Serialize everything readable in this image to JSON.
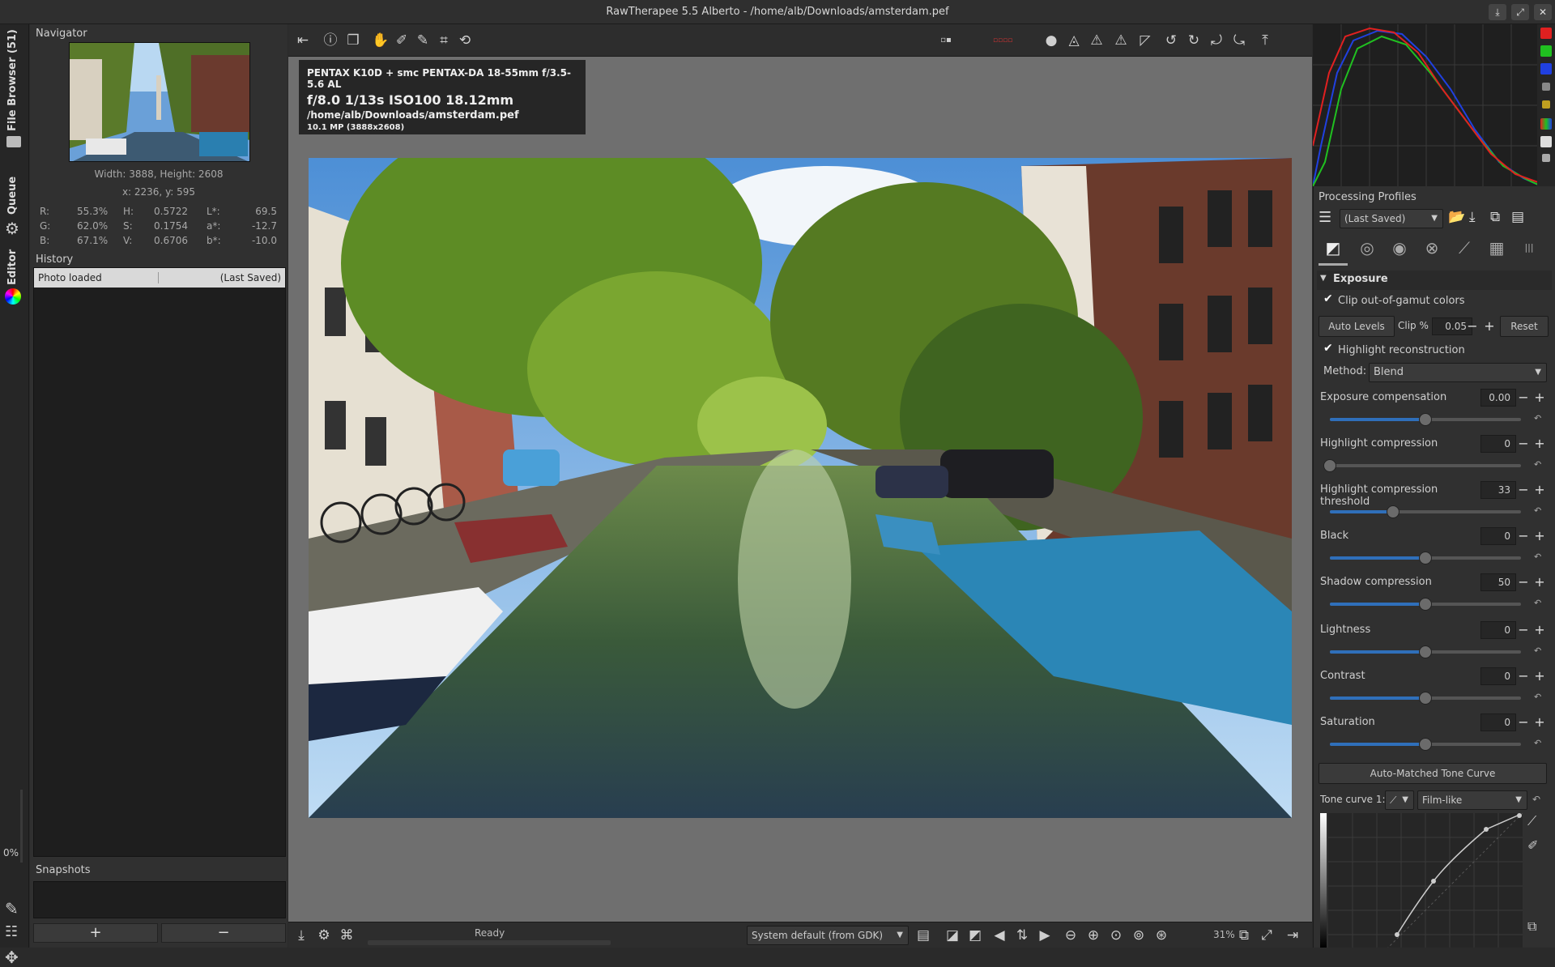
{
  "window": {
    "title": "RawTherapee 5.5 Alberto - /home/alb/Downloads/amsterdam.pef"
  },
  "left_tabs": {
    "file_browser": "File Browser (51)",
    "queue": "Queue",
    "editor": "Editor",
    "zoom_percent": "0%"
  },
  "navigator": {
    "header": "Navigator",
    "dimensions": "Width: 3888, Height: 2608",
    "coords": "x: 2236, y: 595",
    "r_label": "R:",
    "r_value": "55.3%",
    "g_label": "G:",
    "g_value": "62.0%",
    "b_label": "B:",
    "b_value": "67.1%",
    "h_label": "H:",
    "h_value": "0.5722",
    "s_label": "S:",
    "s_value": "0.1754",
    "v_label": "V:",
    "v_value": "0.6706",
    "l_label": "L*:",
    "l_value": "69.5",
    "a_label": "a*:",
    "a_value": "-12.7",
    "bstar_label": "b*:",
    "bstar_value": "-10.0"
  },
  "history": {
    "header": "History",
    "rows": [
      {
        "action": "Photo loaded",
        "value": "(Last Saved)"
      }
    ]
  },
  "snapshots": {
    "header": "Snapshots",
    "add": "+",
    "remove": "−"
  },
  "exif": {
    "camera": "PENTAX K10D + smc PENTAX-DA 18-55mm f/3.5-5.6 AL",
    "exposure": "f/8.0  1/13s  ISO100  18.12mm",
    "path_prefix": "/home/alb/Downloads/",
    "filename": "amsterdam.pef",
    "megapixels": "10.1 MP (3888x2608)"
  },
  "statusbar": {
    "status": "Ready",
    "profile_select": "System default (from GDK)",
    "zoom": "31%"
  },
  "processing_profiles": {
    "header": "Processing Profiles",
    "selected": "(Last Saved)"
  },
  "exposure": {
    "header": "Exposure",
    "clip_oog_label": "Clip out-of-gamut colors",
    "auto_levels": "Auto Levels",
    "clip_label": "Clip %",
    "clip_value": "0.05",
    "reset": "Reset",
    "highlight_recon_label": "Highlight reconstruction",
    "method_label": "Method:",
    "method_value": "Blend",
    "sliders": [
      {
        "label": "Exposure compensation",
        "value": "0.00",
        "fraction": 0.5
      },
      {
        "label": "Highlight compression",
        "value": "0",
        "fraction": 0.0
      },
      {
        "label": "Highlight compression threshold",
        "value": "33",
        "fraction": 0.33
      },
      {
        "label": "Black",
        "value": "0",
        "fraction": 0.5
      },
      {
        "label": "Shadow compression",
        "value": "50",
        "fraction": 0.5
      },
      {
        "label": "Lightness",
        "value": "0",
        "fraction": 0.5
      },
      {
        "label": "Contrast",
        "value": "0",
        "fraction": 0.5
      },
      {
        "label": "Saturation",
        "value": "0",
        "fraction": 0.5
      }
    ],
    "auto_tone_curve": "Auto-Matched Tone Curve",
    "tone_curve_label": "Tone curve 1:",
    "tone_curve_mode": "Film-like"
  },
  "colors": {
    "accent": "#2f6fba",
    "histo_red": "#e02020",
    "histo_green": "#20c020",
    "histo_blue": "#2040e0"
  }
}
